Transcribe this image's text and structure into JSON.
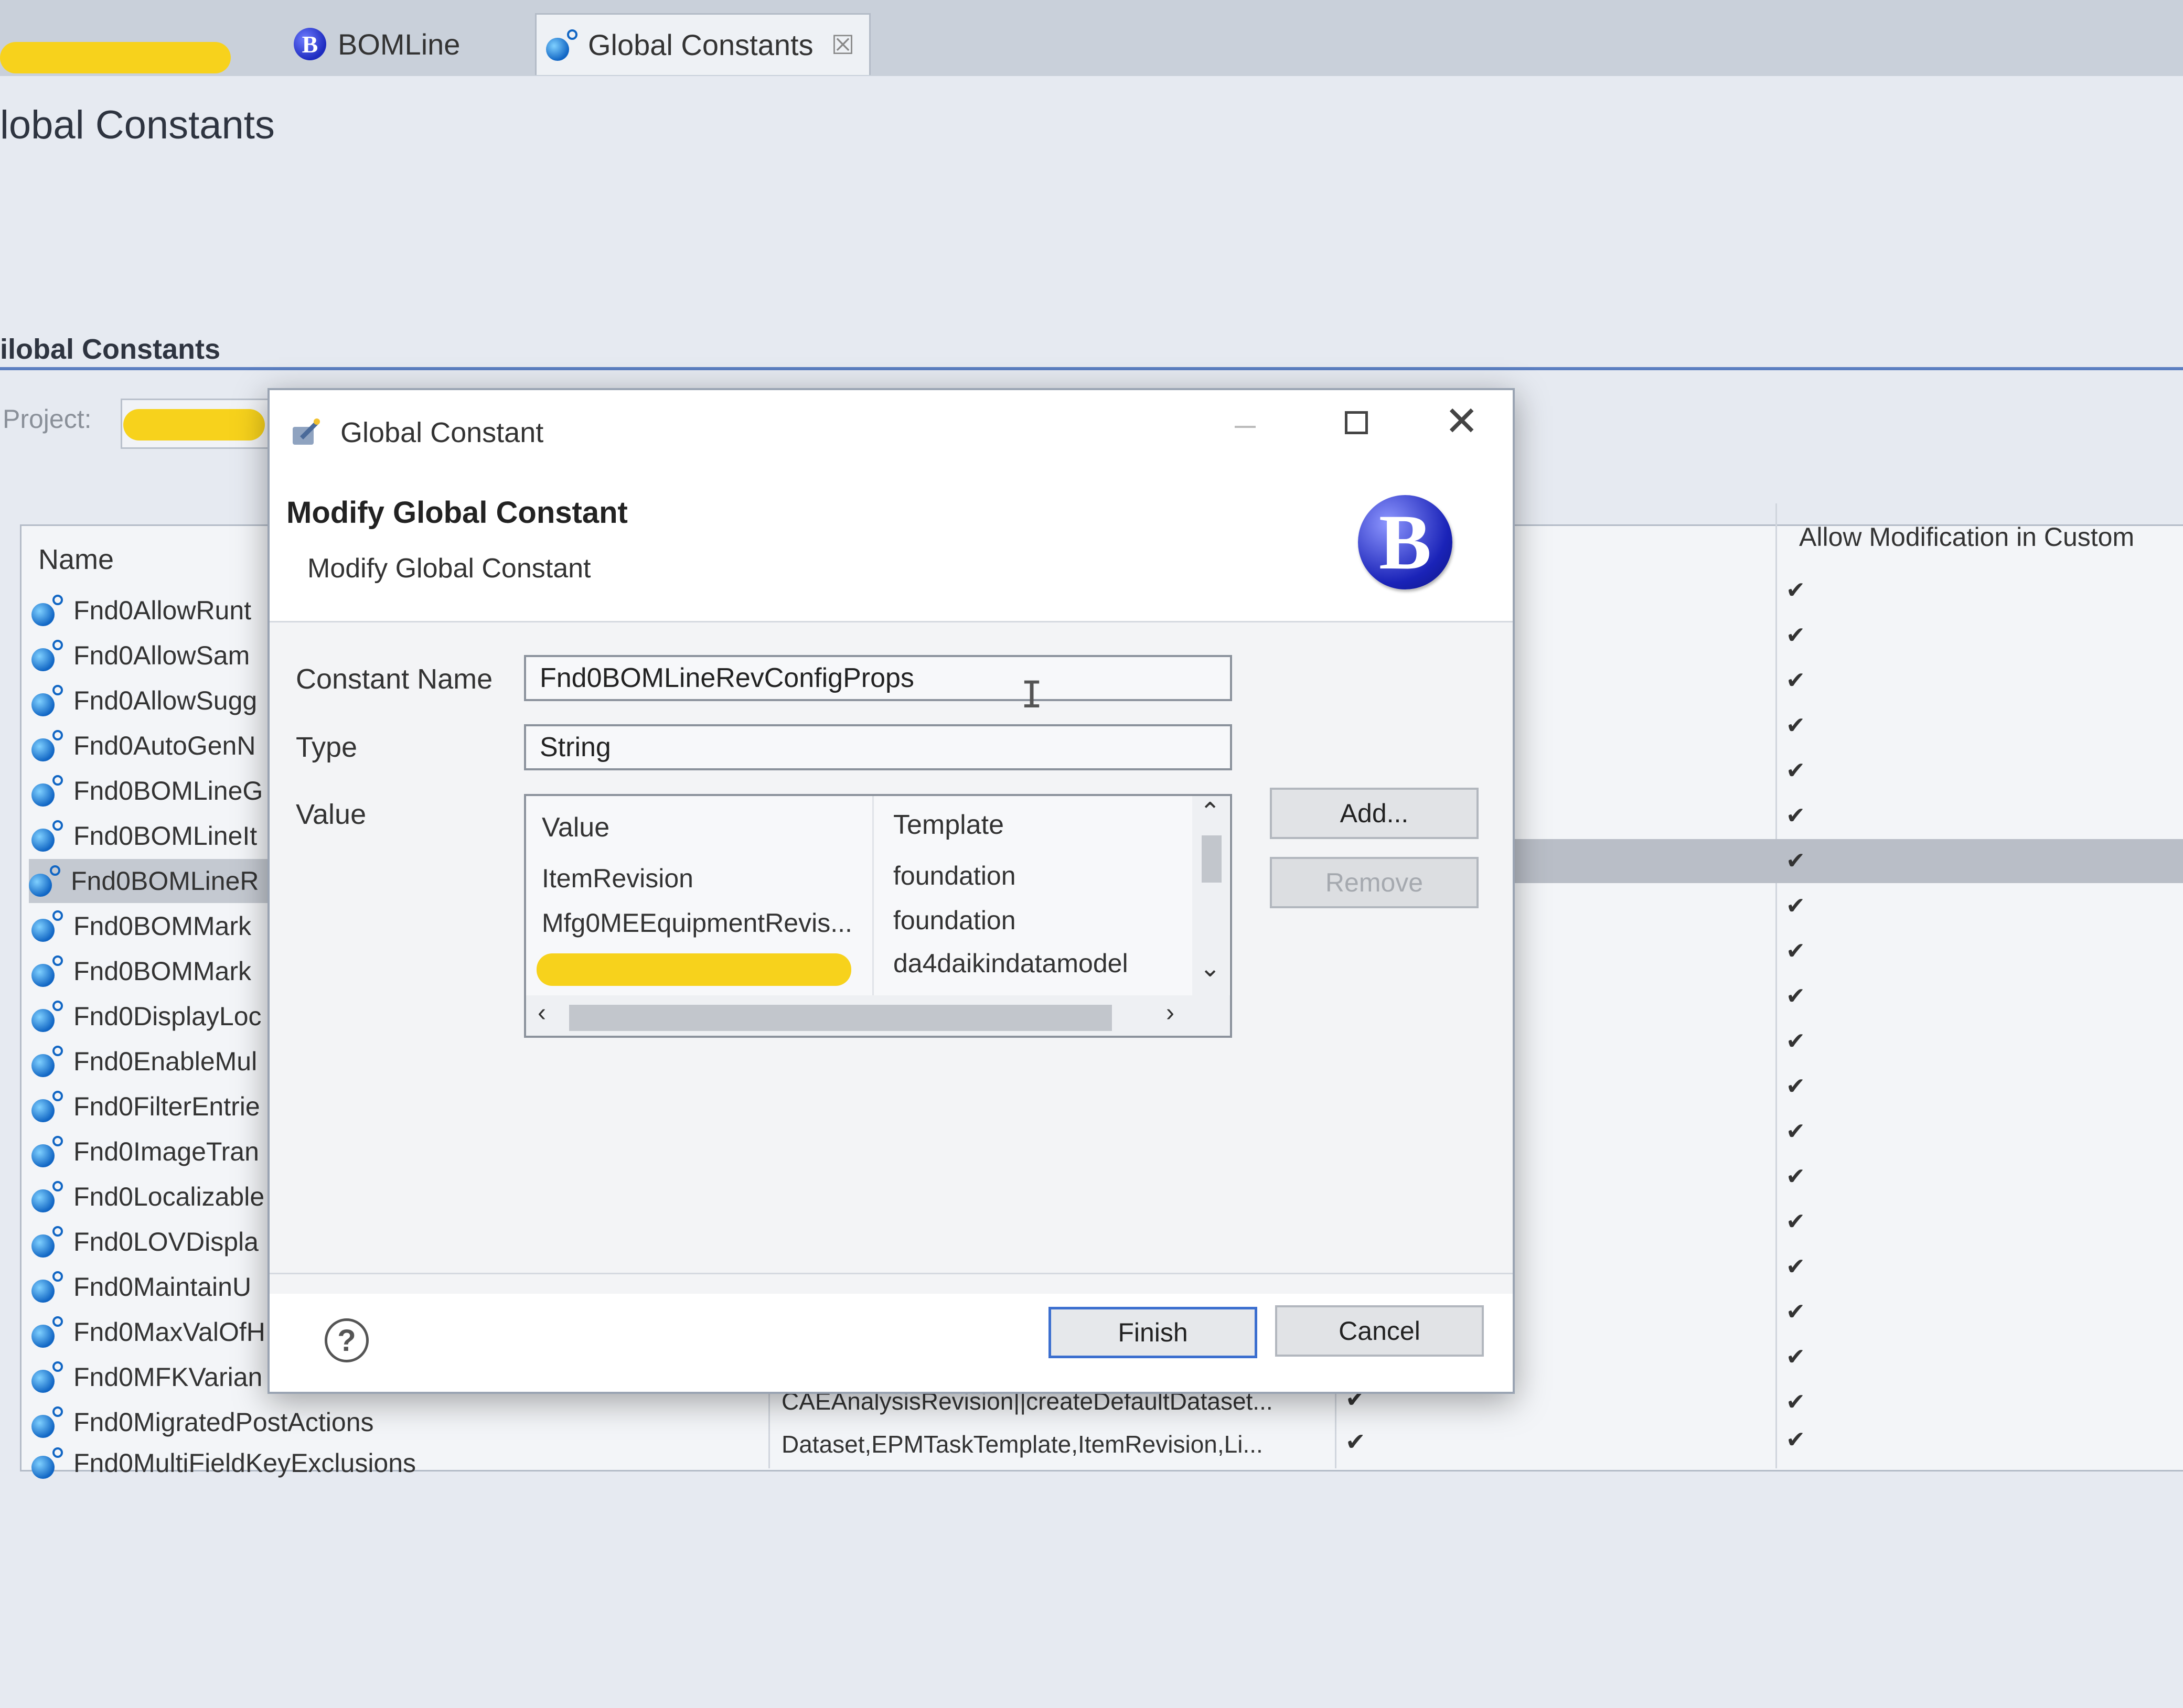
{
  "tabs": [
    {
      "label": "",
      "icon": "redacted"
    },
    {
      "label": "BOMLine",
      "icon": "b-logo-icon"
    },
    {
      "label": "Global Constants",
      "icon": "global-constant-icon",
      "close": "☒"
    }
  ],
  "editor": {
    "page_title": "lobal Constants",
    "section_title": "ilobal Constants",
    "project_label": "Project:",
    "columns": {
      "name": "Name",
      "allow_modification": "Allow Modification in Custom"
    },
    "rows": [
      {
        "name": "Fnd0AllowRunt",
        "check": "✔"
      },
      {
        "name": "Fnd0AllowSam",
        "check": "✔"
      },
      {
        "name": "Fnd0AllowSugg",
        "check": "✔"
      },
      {
        "name": "Fnd0AutoGenN",
        "check": "✔"
      },
      {
        "name": "Fnd0BOMLineG",
        "check": "✔"
      },
      {
        "name": "Fnd0BOMLineIt",
        "check": "✔"
      },
      {
        "name": "Fnd0BOMLineR",
        "check": "✔",
        "selected": true
      },
      {
        "name": "Fnd0BOMMark",
        "check": "✔"
      },
      {
        "name": "Fnd0BOMMark",
        "check": "✔"
      },
      {
        "name": "Fnd0DisplayLoc",
        "check": "✔"
      },
      {
        "name": "Fnd0EnableMul",
        "check": "✔"
      },
      {
        "name": "Fnd0FilterEntrie",
        "check": "✔"
      },
      {
        "name": "Fnd0ImageTran",
        "check": "✔"
      },
      {
        "name": "Fnd0Localizable",
        "check": "✔"
      },
      {
        "name": "Fnd0LOVDispla",
        "check": "✔"
      },
      {
        "name": "Fnd0MaintainU",
        "check": "✔"
      },
      {
        "name": "Fnd0MaxValOfH",
        "check": "✔"
      },
      {
        "name": "Fnd0MFKVarian",
        "check": "✔"
      },
      {
        "name": "Fnd0MigratedPostActions",
        "value": "CAEAnalysisRevision||createDefaultDataset...",
        "mid_check": "✔",
        "check": "✔"
      },
      {
        "name": "Fnd0MultiFieldKeyExclusions",
        "value": "Dataset,EPMTaskTemplate,ItemRevision,Li...",
        "mid_check": "✔",
        "check": "✔"
      }
    ]
  },
  "dialog": {
    "title": "Global Constant",
    "banner_title": "Modify Global Constant",
    "banner_subtitle": "Modify Global Constant",
    "banner_logo": "B",
    "constant_name_label": "Constant Name",
    "constant_name_value": "Fnd0BOMLineRevConfigProps",
    "type_label": "Type",
    "type_value": "String",
    "value_label": "Value",
    "value_table": {
      "headers": [
        "Value",
        "Template"
      ],
      "rows": [
        {
          "value": "ItemRevision",
          "template": "foundation"
        },
        {
          "value": "Mfg0MEEquipmentRevis...",
          "template": "foundation"
        },
        {
          "value": "",
          "template": "da4daikindatamodel"
        }
      ]
    },
    "add_label": "Add...",
    "remove_label": "Remove",
    "finish_label": "Finish",
    "cancel_label": "Cancel",
    "help_glyph": "?",
    "close_glyph": "✕"
  },
  "colors": {
    "accent": "#3c6fcf",
    "redaction": "#f7d21c",
    "logo_blue": "#1a23b8"
  }
}
